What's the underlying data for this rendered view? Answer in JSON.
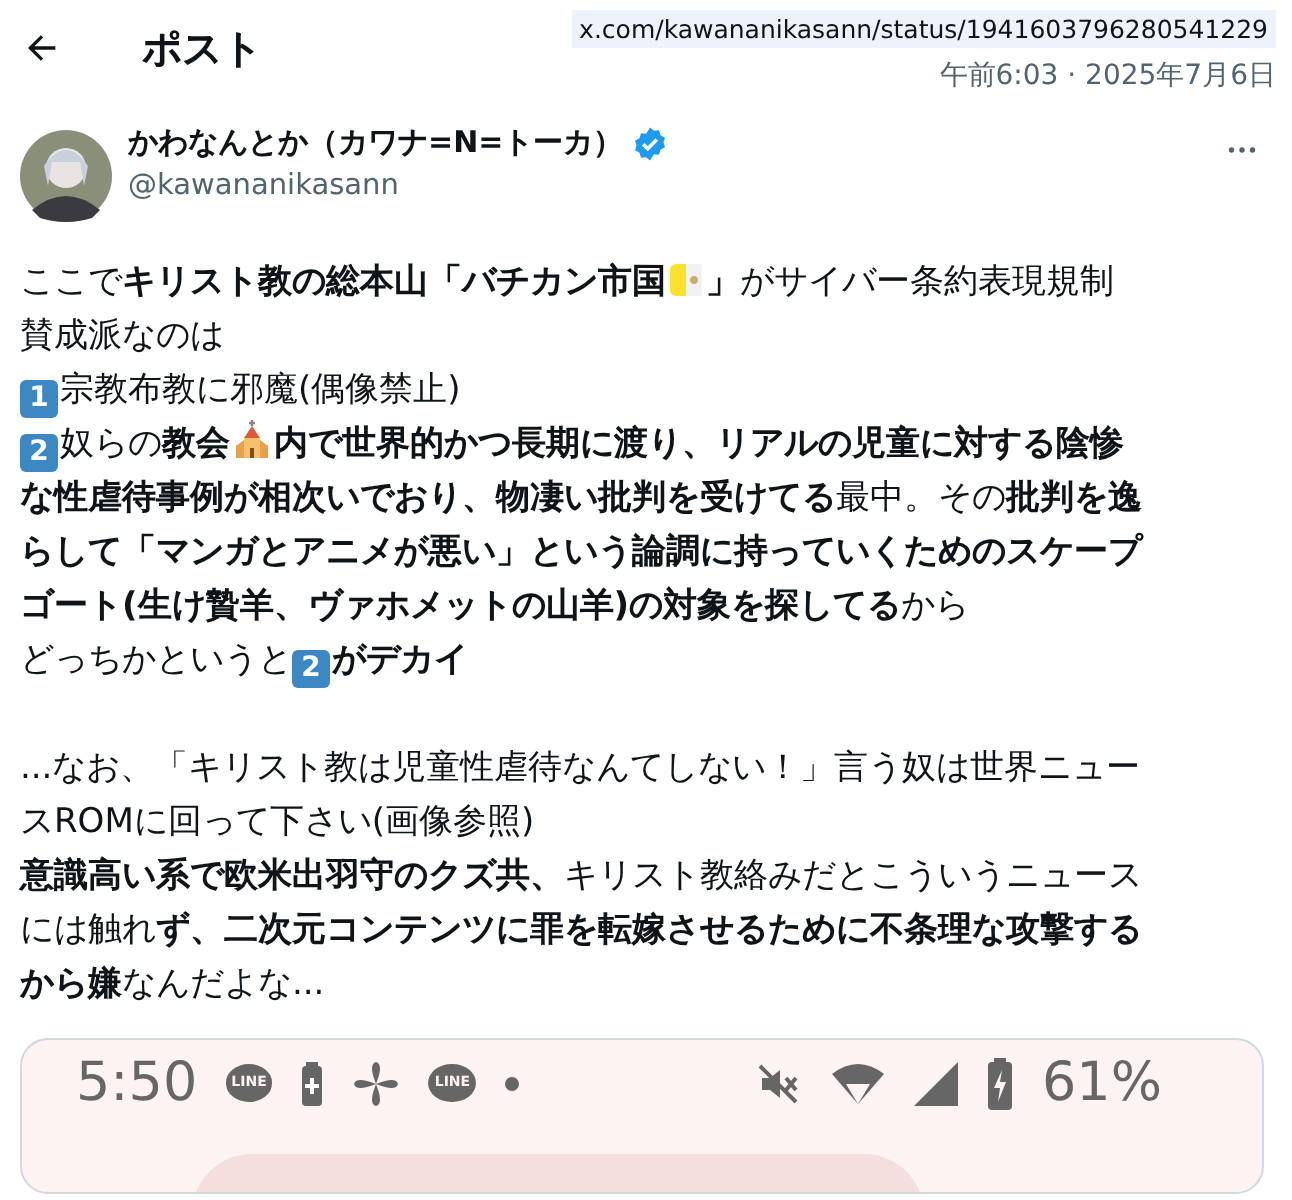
{
  "header": {
    "title": "ポスト",
    "url": "x.com/kawananikasann/status/1941603796280541229",
    "timestamp": "午前6:03 · 2025年7月6日"
  },
  "author": {
    "name": "かわなんとか（カワナ=N=トーカ）",
    "handle": "@kawananikasann",
    "verified": true
  },
  "body": [
    [
      [
        {
          "kind": "text",
          "text": "ここで**キリスト教の総本山「バチカン市国**"
        },
        {
          "kind": "flag"
        },
        {
          "kind": "text",
          "text": "**」**がサイバー条約表現規制"
        }
      ],
      [
        {
          "kind": "text",
          "text": "賛成派なのは"
        }
      ],
      [
        {
          "kind": "keycap",
          "text": "1"
        },
        {
          "kind": "text",
          "text": "宗教布教に邪魔(偶像禁止)"
        }
      ],
      [
        {
          "kind": "keycap",
          "text": "2"
        },
        {
          "kind": "text",
          "text": "奴らの**教会**"
        },
        {
          "kind": "church"
        },
        {
          "kind": "text",
          "text": "**内で世界的かつ長期に渡り、リアルの児童に対する陰惨**"
        }
      ],
      [
        {
          "kind": "text",
          "text": "**な性虐待事例が相次いでおり、物凄い批判を受けてる**最中。その**批判を逸**"
        }
      ],
      [
        {
          "kind": "text",
          "text": "**らして「マンガとアニメが悪い」という論調に持っていくためのスケープ**"
        }
      ],
      [
        {
          "kind": "text",
          "text": "**ゴート(生け贄羊、ヴァホメットの山羊)の対象を探してる**から"
        }
      ],
      [
        {
          "kind": "text",
          "text": "どっちかというと"
        },
        {
          "kind": "keycap",
          "text": "2"
        },
        {
          "kind": "text",
          "text": "**がデカイ**"
        }
      ]
    ],
    [
      [
        {
          "kind": "text",
          "text": "...なお、「キリスト教は児童性虐待なんてしない！」言う奴は世界ニュー"
        }
      ],
      [
        {
          "kind": "text",
          "text": "スROMに回って下さい(画像参照)"
        }
      ],
      [
        {
          "kind": "text",
          "text": "**意識高い系で欧米出羽守のクズ共、**キリスト教絡みだとこういうニュース"
        }
      ],
      [
        {
          "kind": "text",
          "text": "には触れ**ず、二次元コンテンツに罪を転嫁させるために不条理な攻撃する**"
        }
      ],
      [
        {
          "kind": "text",
          "text": "**から嫌**なんだよな..."
        }
      ]
    ]
  ],
  "attachment": {
    "status_bar": {
      "left": [
        {
          "kind": "time",
          "text": "5:50"
        },
        {
          "kind": "chat",
          "text": "LINE"
        },
        {
          "kind": "battery-plus"
        },
        {
          "kind": "pinwheel"
        },
        {
          "kind": "chat",
          "text": "LINE"
        },
        {
          "kind": "dot"
        }
      ],
      "right": [
        {
          "kind": "mute"
        },
        {
          "kind": "wifi"
        },
        {
          "kind": "signal"
        },
        {
          "kind": "battery"
        },
        {
          "kind": "percent",
          "text": "61%"
        }
      ]
    }
  }
}
